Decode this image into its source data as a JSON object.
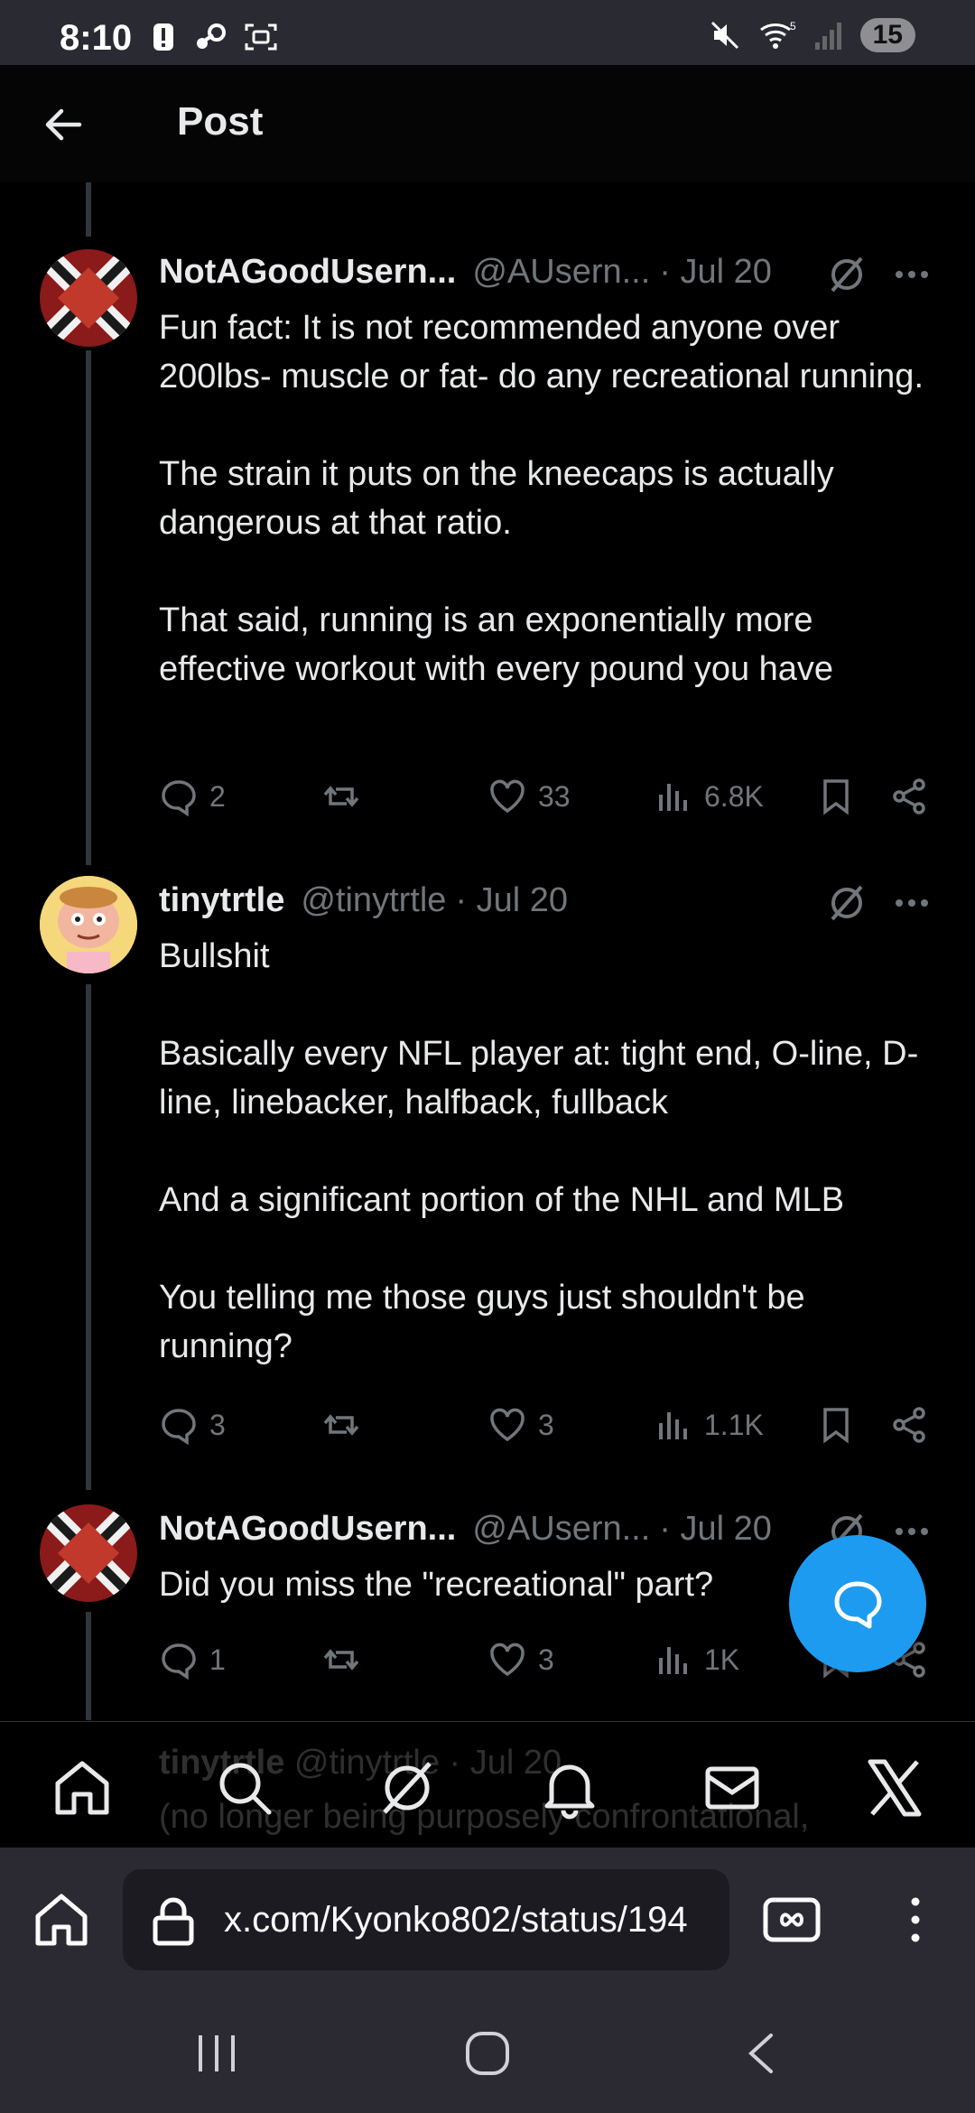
{
  "status": {
    "time": "8:10",
    "battery": "15"
  },
  "header": {
    "title": "Post"
  },
  "posts": [
    {
      "name": "NotAGoodUsern...",
      "handle": "@AUsern...",
      "date": "· Jul 20",
      "text": "Fun fact: It is not recommended anyone over 200lbs- muscle or fat- do any recreational running.\n\nThe strain it puts on the kneecaps is actually dangerous at that ratio.\n\nThat said, running is an exponentially more effective workout with every pound you have",
      "replies": "2",
      "reposts": "",
      "likes": "33",
      "views": "6.8K"
    },
    {
      "name": "tinytrtle",
      "handle": "@tinytrtle",
      "date": "· Jul 20",
      "text": "Bullshit\n\nBasically every NFL player at: tight end, O-line, D-line, linebacker, halfback, fullback\n\nAnd a significant portion of the NHL and MLB\n\nYou telling me those guys just shouldn't be running?",
      "replies": "3",
      "reposts": "",
      "likes": "3",
      "views": "1.1K"
    },
    {
      "name": "NotAGoodUsern...",
      "handle": "@AUsern...",
      "date": "· Jul 20",
      "text": "Did you miss the \"recreational\" part?",
      "replies": "1",
      "reposts": "",
      "likes": "3",
      "views": "1K"
    }
  ],
  "hidden_next": {
    "name": "tinytrtle",
    "handle": "@tinytrtle",
    "date": "· Jul 20",
    "text": "(no longer being purposely confrontational,"
  },
  "browser": {
    "url": "x.com/Kyonko802/status/194"
  },
  "icons": {
    "back": "arrow-left-icon",
    "grok": "grok-icon",
    "more": "more-icon",
    "reply": "reply-icon",
    "repost": "repost-icon",
    "like": "heart-icon",
    "views": "views-icon",
    "bookmark": "bookmark-icon",
    "share": "share-icon",
    "home": "home-icon",
    "search": "search-icon",
    "notifications": "bell-icon",
    "messages": "mail-icon",
    "x": "x-logo-icon"
  },
  "colors": {
    "accent": "#1d9bf0",
    "text": "#e7e9ea",
    "muted": "#71767b",
    "background": "#000000"
  }
}
